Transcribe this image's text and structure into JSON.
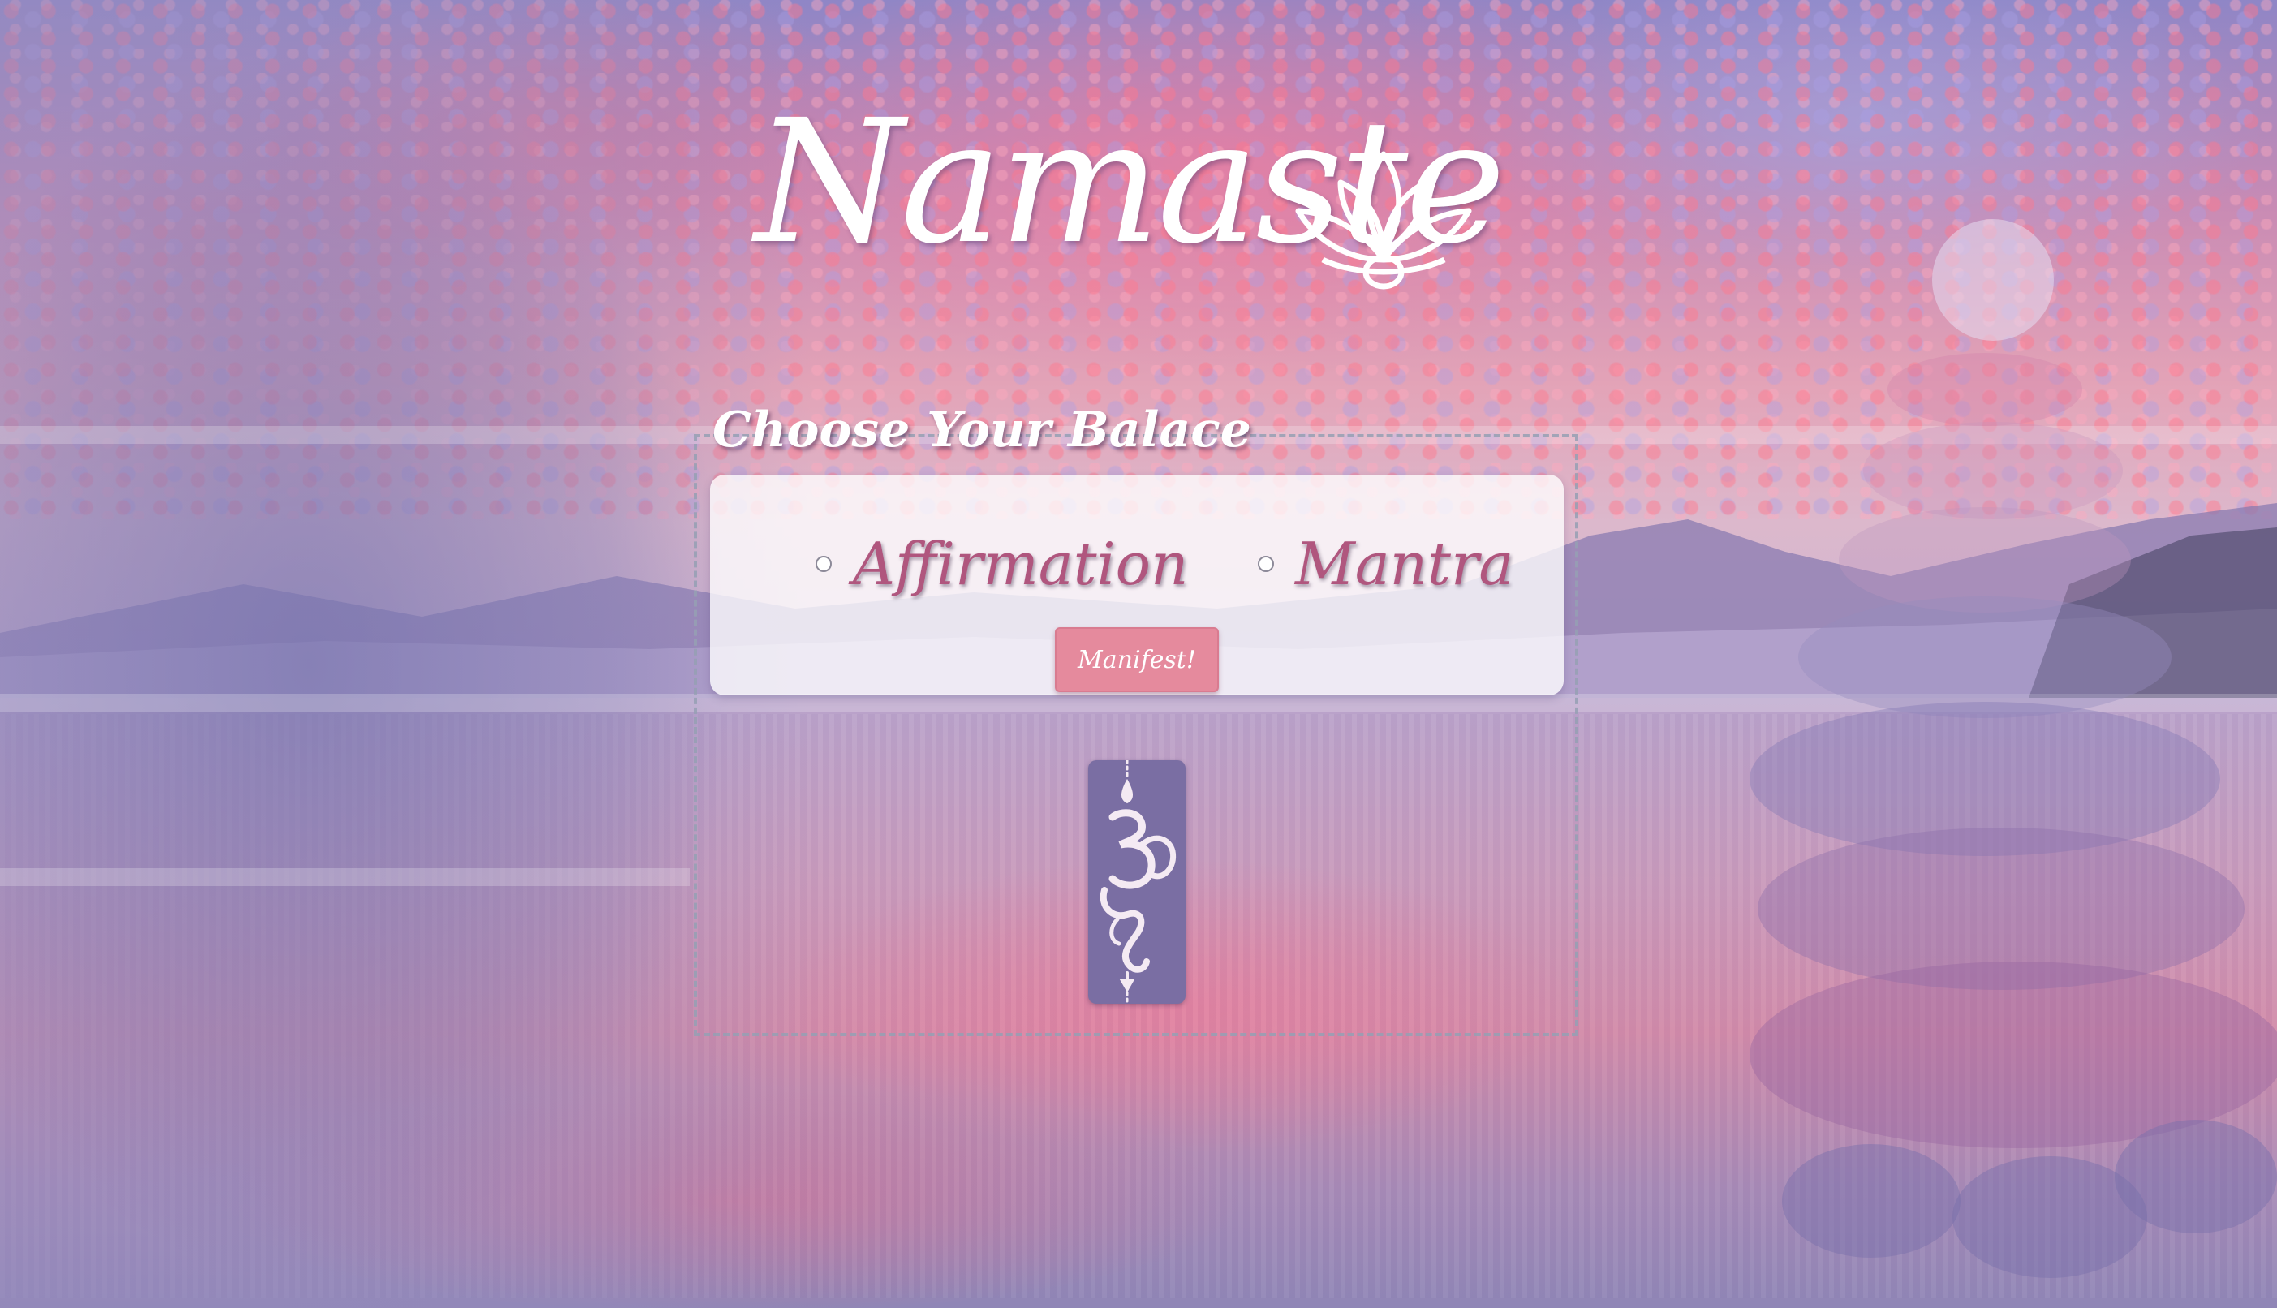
{
  "header": {
    "title": "Namaste",
    "logo_icon": "lotus-icon"
  },
  "form": {
    "heading": "Choose Your Balace",
    "options": [
      {
        "label": "Affirmation",
        "selected": false
      },
      {
        "label": "Mantra",
        "selected": false
      }
    ],
    "submit_label": "Manifest!"
  },
  "result": {
    "icon": "om-icon"
  },
  "colors": {
    "accent_button": "#e58a9d",
    "option_text": "#b0567e",
    "om_card": "#7a6ea3"
  }
}
